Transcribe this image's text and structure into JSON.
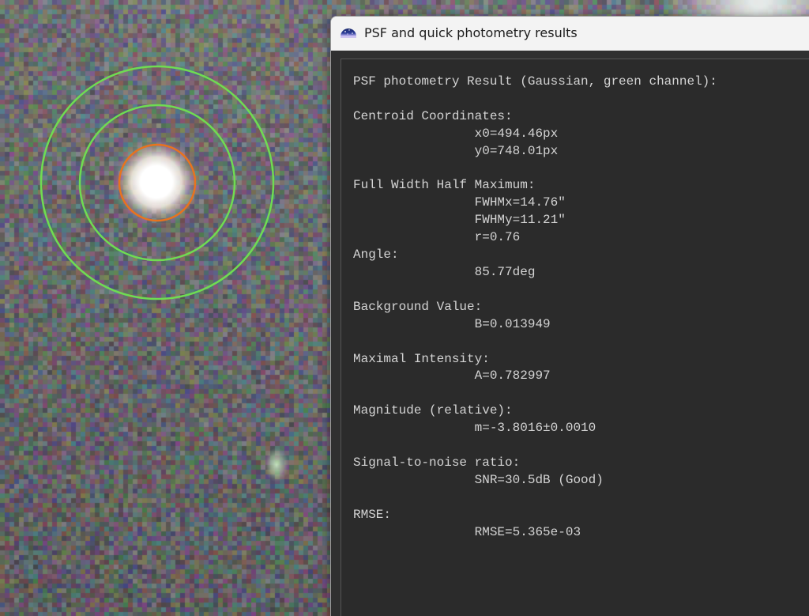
{
  "window": {
    "title": "PSF and quick photometry results",
    "app_icon": "siril-app-icon"
  },
  "results": {
    "heading": "PSF photometry Result (Gaussian, green channel):",
    "centroid_label": "Centroid Coordinates:",
    "x0": "x0=494.46px",
    "y0": "y0=748.01px",
    "fwhm_label": "Full Width Half Maximum:",
    "fwhmx": "FWHMx=14.76\"",
    "fwhmy": "FWHMy=11.21\"",
    "r": "r=0.76",
    "angle_label": "Angle:",
    "angle": "85.77deg",
    "background_label": "Background Value:",
    "background": "B=0.013949",
    "intensity_label": "Maximal Intensity:",
    "intensity": "A=0.782997",
    "magnitude_label": "Magnitude (relative):",
    "magnitude": "m=-3.8016±0.0010",
    "snr_label": "Signal-to-noise ratio:",
    "snr": "SNR=30.5dB (Good)",
    "rmse_label": "RMSE:",
    "rmse": "RMSE=5.365e-03"
  },
  "image_view": {
    "star_core_color": "#ffffff",
    "inner_circle_color": "#e8731e",
    "annulus_color": "#6fdc52",
    "background_color": "#6f7378"
  }
}
